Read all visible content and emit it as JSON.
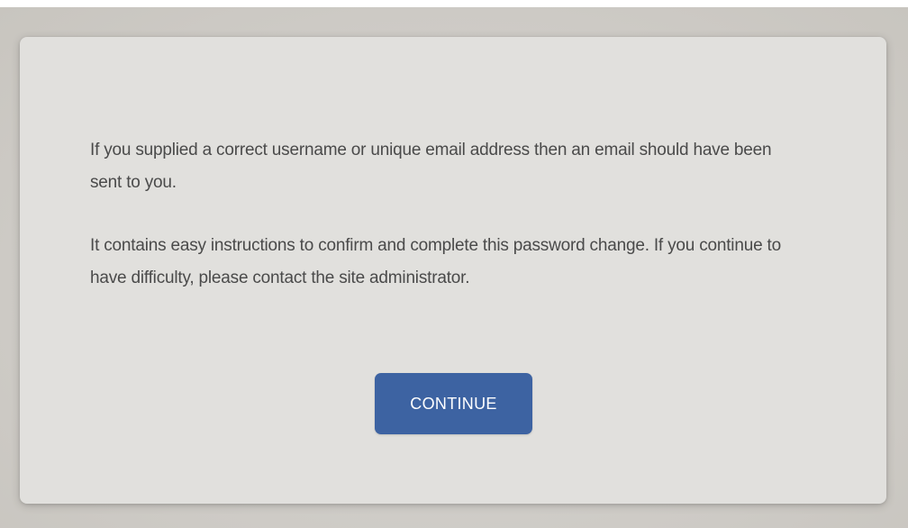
{
  "message": {
    "paragraph_1": "If you supplied a correct username or unique email address then an email should have been sent to you.",
    "paragraph_2": "It contains easy instructions to confirm and complete this password change. If you continue to have difficulty, please contact the site administrator."
  },
  "actions": {
    "continue_label": "CONTINUE"
  },
  "colors": {
    "page_background": "#cecbc6",
    "card_background": "#e1e0dd",
    "text": "#4a4a4a",
    "button_background": "#3d63a2",
    "button_text": "#ffffff"
  }
}
